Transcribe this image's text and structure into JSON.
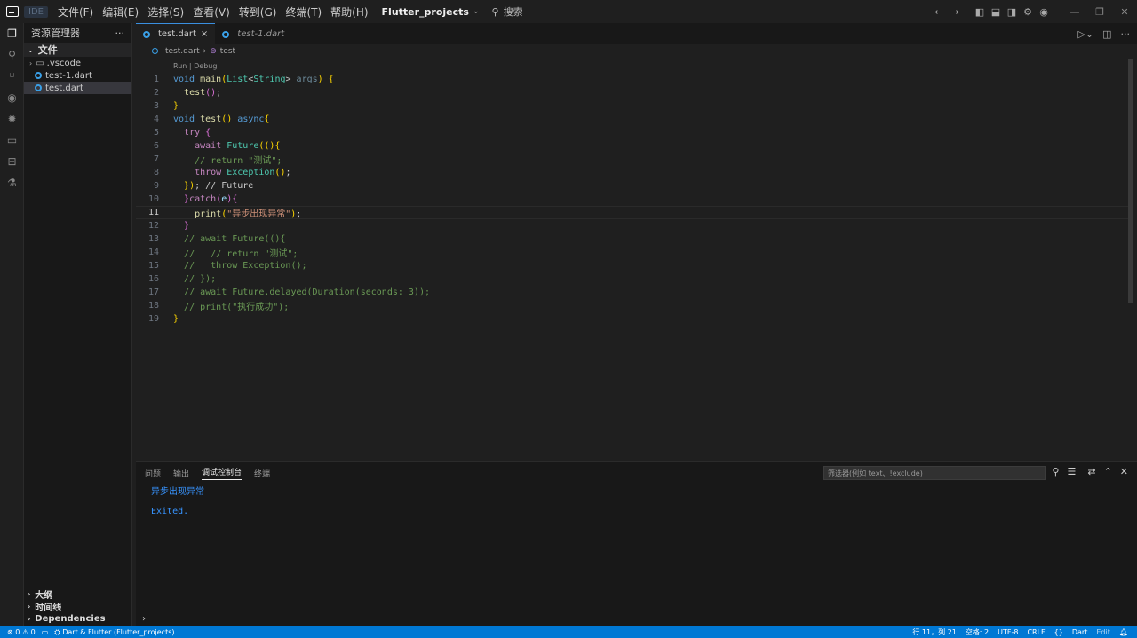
{
  "titlebar": {
    "ide_badge": "IDE",
    "menu": [
      "文件(F)",
      "编辑(E)",
      "选择(S)",
      "查看(V)",
      "转到(G)",
      "终端(T)",
      "帮助(H)"
    ],
    "project": "Flutter_projects",
    "search_label": "搜索"
  },
  "sidebar": {
    "title": "资源管理器",
    "more": "···",
    "root": "文件",
    "items": [
      {
        "label": ".vscode",
        "kind": "folder"
      },
      {
        "label": "test-1.dart",
        "kind": "dart-file"
      },
      {
        "label": "test.dart",
        "kind": "dart-file",
        "selected": true
      }
    ],
    "bottom_sections": [
      "大纲",
      "时间线",
      "Dependencies"
    ]
  },
  "tabs": [
    {
      "label": "test.dart",
      "active": true,
      "close": "×"
    },
    {
      "label": "test-1.dart",
      "active": false
    }
  ],
  "breadcrumb": {
    "file": "test.dart",
    "symbol": "test"
  },
  "editor": {
    "codelens": "Run | Debug",
    "current_line": 11,
    "line_numbers": [
      "1",
      "2",
      "3",
      "4",
      "5",
      "6",
      "7",
      "8",
      "9",
      "10",
      "11",
      "12",
      "13",
      "14",
      "15",
      "16",
      "17",
      "18",
      "19"
    ],
    "tokens": {
      "void": "void",
      "main": "main",
      "List": "List",
      "String": "String",
      "args": "args",
      "test": "test",
      "async": "async",
      "try": "try",
      "await": "await",
      "Future": "Future",
      "return_cm": "// return \"测试\";",
      "throw": "throw",
      "Exception": "Exception",
      "future_cm": "// Future",
      "catch": "catch",
      "e": "e",
      "print": "print",
      "str_async": "\"异步出现异常\"",
      "l13": "// await Future((){",
      "l14": "//   // return \"测试\";",
      "l15": "//   throw Exception();",
      "l16": "// });",
      "l17": "// await Future.delayed(Duration(seconds: 3));",
      "l18": "// print(\"执行成功\");"
    }
  },
  "panel": {
    "tabs": [
      "问题",
      "输出",
      "调试控制台",
      "终端"
    ],
    "active_tab": "调试控制台",
    "filter_placeholder": "筛选器(例如 text、!exclude)",
    "output": [
      "异步出现异常",
      "Exited."
    ],
    "prompt": "›"
  },
  "statusbar": {
    "errors": "0",
    "warnings": "0",
    "target": "Dart & Flutter (Flutter_projects)",
    "position": "行 11，列 21",
    "spaces": "空格: 2",
    "encoding": "UTF-8",
    "eol": "CRLF",
    "braces": "{}",
    "language": "Dart",
    "mode": "Edit"
  },
  "colors": {
    "accent": "#0078d4",
    "tab_border": "#3a8fe0",
    "keyword": "#569cd6",
    "string": "#ce9178",
    "comment": "#6a9955"
  }
}
